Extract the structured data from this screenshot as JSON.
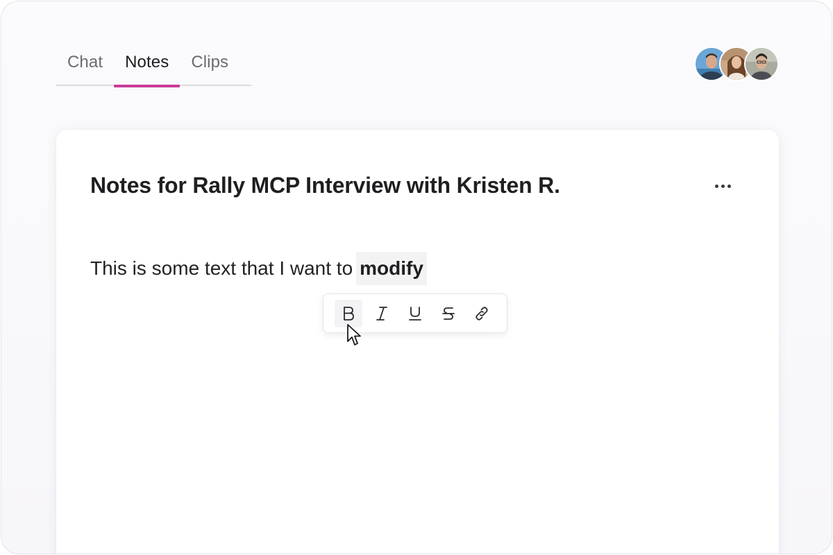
{
  "tabs": [
    {
      "label": "Chat",
      "active": false
    },
    {
      "label": "Notes",
      "active": true
    },
    {
      "label": "Clips",
      "active": false
    }
  ],
  "accent_color": "#c93b96",
  "avatars": [
    {
      "name": "avatar-user-1"
    },
    {
      "name": "avatar-user-2"
    },
    {
      "name": "avatar-user-3"
    }
  ],
  "note": {
    "title": "Notes for Rally MCP Interview with Kristen R.",
    "body_plain": "This is some text that I want to",
    "body_selected": "modify"
  },
  "toolbar": {
    "buttons": [
      {
        "icon": "bold-icon",
        "hovered": true
      },
      {
        "icon": "italic-icon"
      },
      {
        "icon": "underline-icon"
      },
      {
        "icon": "strikethrough-icon"
      },
      {
        "icon": "link-icon"
      }
    ]
  },
  "more_menu_icon": "ellipsis-icon"
}
